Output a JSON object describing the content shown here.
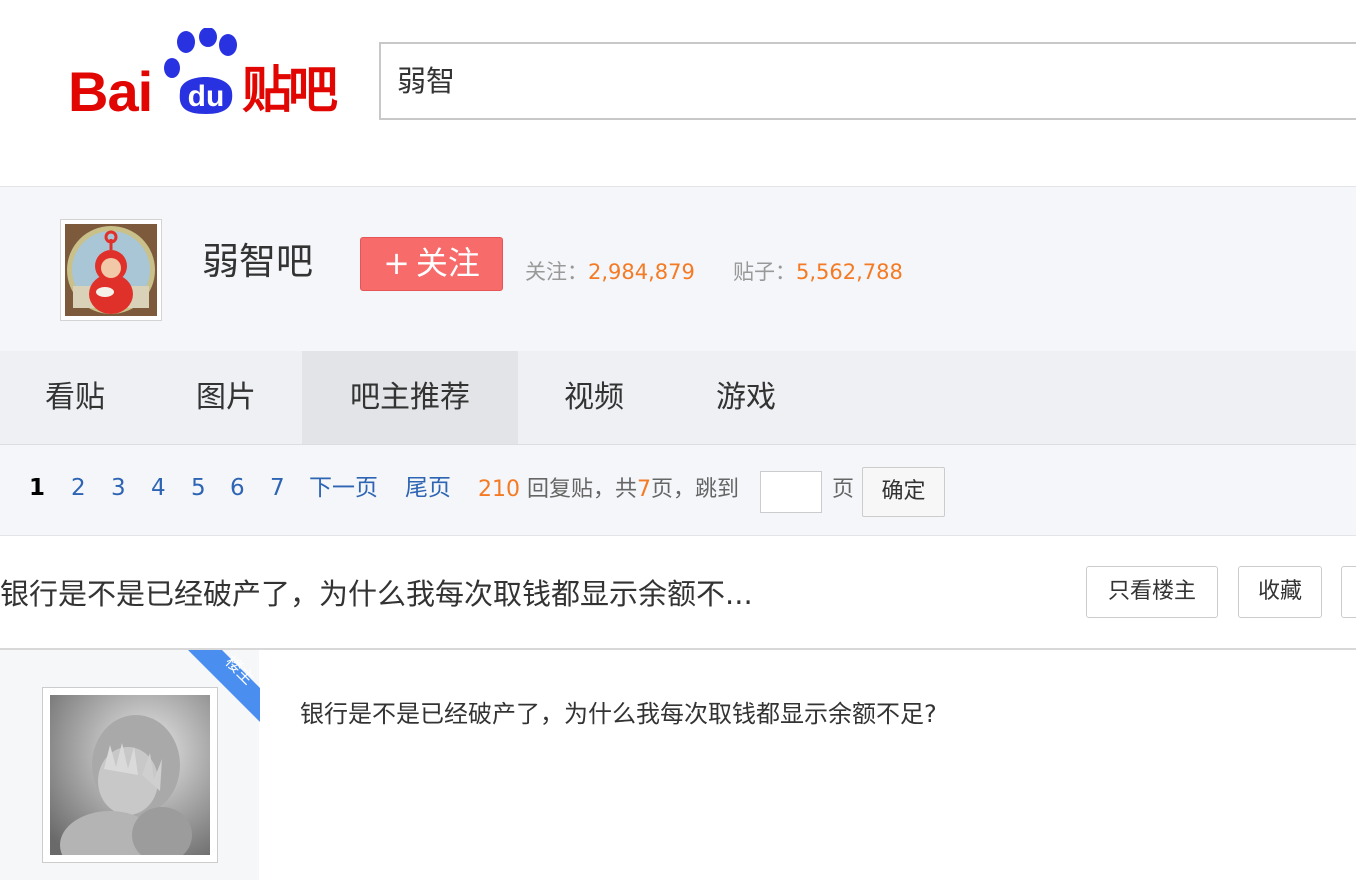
{
  "header": {
    "logo_text_latin": "Bai",
    "logo_text_du": "du",
    "logo_text_cn": "贴吧",
    "search_value": "弱智"
  },
  "forum": {
    "name": "弱智吧",
    "follow_label": "关注",
    "follow_plus": "+",
    "followers_label": "关注：",
    "followers_value": "2,984,879",
    "posts_label": "贴子：",
    "posts_value": "5,562,788"
  },
  "nav": {
    "tabs": [
      {
        "label": "看贴",
        "active": false
      },
      {
        "label": "图片",
        "active": false
      },
      {
        "label": "吧主推荐",
        "active": true
      },
      {
        "label": "视频",
        "active": false
      },
      {
        "label": "游戏",
        "active": false
      }
    ]
  },
  "pager": {
    "pages": [
      "1",
      "2",
      "3",
      "4",
      "5",
      "6",
      "7"
    ],
    "current": "1",
    "next_label": "下一页",
    "last_label": "尾页",
    "reply_count": "210",
    "reply_text": "回复贴，共",
    "total_pages": "7",
    "pages_suffix": "页，跳到",
    "page_unit": "页",
    "confirm_label": "确定"
  },
  "thread": {
    "title": "银行是不是已经破产了，为什么我每次取钱都显示余额不...",
    "only_op_label": "只看楼主",
    "favorite_label": "收藏"
  },
  "post": {
    "badge": "楼主",
    "content": "银行是不是已经破产了，为什么我每次取钱都显示余额不足?"
  },
  "colors": {
    "brand_red": "#e10601",
    "paw_blue": "#2932e1",
    "follow_button": "#f76b6b",
    "stat_orange": "#f57a24",
    "link_blue": "#2d64b3",
    "badge_blue": "#4a8ff0"
  }
}
